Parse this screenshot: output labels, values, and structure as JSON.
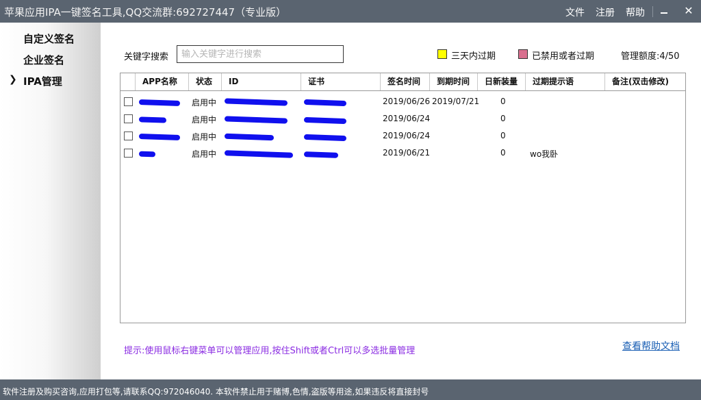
{
  "window": {
    "title": "苹果应用IPA一键签名工具,QQ交流群:692727447（专业版）",
    "menu": [
      "文件",
      "注册",
      "帮助"
    ]
  },
  "sidebar": {
    "items": [
      {
        "label": "自定义签名",
        "active": false
      },
      {
        "label": "企业签名",
        "active": false
      },
      {
        "label": "IPA管理",
        "active": true
      }
    ],
    "active_marker": "❯"
  },
  "search": {
    "label": "关键字搜索",
    "placeholder": "输入关键字进行搜索",
    "value": ""
  },
  "legend": {
    "items": [
      {
        "label": "三天内过期",
        "color": "#ffff00"
      },
      {
        "label": "已禁用或者过期",
        "color": "#d9708f"
      }
    ]
  },
  "quota": "管理额度:4/50",
  "table": {
    "headers": [
      "",
      "APP名称",
      "状态",
      "ID",
      "证书",
      "签名时间",
      "到期时间",
      "日新装量",
      "过期提示语",
      "备注(双击修改)"
    ],
    "rows": [
      {
        "name": "",
        "status": "启用中",
        "id": "",
        "cert": "",
        "sign_time": "2019/06/26",
        "expire_time": "2019/07/21",
        "installs": "0",
        "tip": "",
        "note": ""
      },
      {
        "name": "",
        "status": "启用中",
        "id": "",
        "cert": "",
        "sign_time": "2019/06/24",
        "expire_time": "",
        "installs": "0",
        "tip": "",
        "note": ""
      },
      {
        "name": "",
        "status": "启用中",
        "id": "",
        "cert": "",
        "sign_time": "2019/06/24",
        "expire_time": "",
        "installs": "0",
        "tip": "",
        "note": ""
      },
      {
        "name": "",
        "status": "启用中",
        "id": "",
        "cert": "",
        "sign_time": "2019/06/21",
        "expire_time": "",
        "installs": "0",
        "tip": "wo我卧",
        "note": ""
      }
    ]
  },
  "hint": "提示:使用鼠标右键菜单可以管理应用,按住Shift或者Ctrl可以多选批量管理",
  "help_link": "查看帮助文档",
  "status_bar": "软件注册及购买咨询,应用打包等,请联系QQ:972046040. 本软件禁止用于赌博,色情,盗版等用途,如果违反将直接封号",
  "colors": {
    "titlebar": "#5a6470",
    "hint": "#8a2be2",
    "link": "#1a5fb4",
    "redaction": "#1010ee"
  }
}
